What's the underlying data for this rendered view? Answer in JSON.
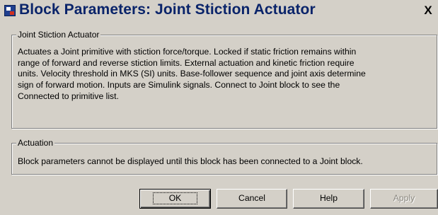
{
  "window": {
    "title": "Block Parameters: Joint Stiction Actuator",
    "close_glyph": "X"
  },
  "groups": [
    {
      "legend": "Joint Stiction Actuator",
      "lines": [
        "Actuates a Joint primitive with stiction force/torque. Locked if static friction remains within",
        "range of forward and reverse stiction limits. External actuation and kinetic friction require",
        "units. Velocity threshold in MKS (SI) units. Base-follower sequence and joint axis determine",
        "sign of forward motion. Inputs are Simulink signals. Connect to Joint block to see the",
        "Connected to primitive list."
      ]
    },
    {
      "legend": "Actuation",
      "lines": [
        "Block parameters cannot be displayed until this block has been connected to a Joint block."
      ]
    }
  ],
  "buttons": {
    "ok": "OK",
    "cancel": "Cancel",
    "help": "Help",
    "apply": "Apply"
  }
}
